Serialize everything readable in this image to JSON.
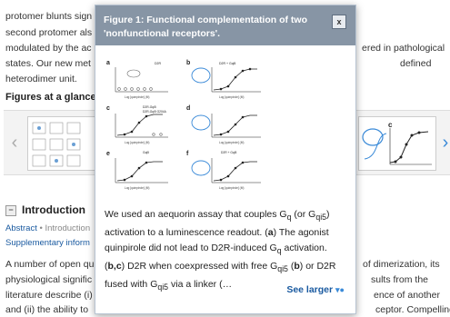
{
  "article": {
    "lines_left": [
      "protomer blunts sign",
      "second protomer als",
      "modulated by the ac",
      "states. Our new met",
      "heterodimer unit."
    ],
    "lines_right": [
      "ered in pathological",
      "defined"
    ],
    "figures_heading": "Figures at a glance",
    "intro_heading": "Introduction",
    "toggle_symbol": "−",
    "abstract_label": "Abstract",
    "breadcrumb_sep": " • Introduction",
    "supp_label": "Supplementary inform",
    "bottom_left": [
      "A number of open qu",
      "physiological signific",
      "literature describe (i)",
      "and (ii) the ability to"
    ],
    "bottom_right": [
      "of dimerization, its",
      "sults from the",
      "ence of another",
      "ceptor. Compelling"
    ],
    "carousel_prev": "‹",
    "carousel_next": "›"
  },
  "popup": {
    "title": "Figure 1: Functional complementation of two 'nonfunctional receptors'.",
    "close_label": "x",
    "caption_parts": {
      "p1": "We used an aequorin assay that couples G",
      "q1": "q",
      "p2": " (or G",
      "qi5_1": "qi5",
      "p3": ") activation to a luminescence readout. (",
      "a": "a",
      "p4": ") The agonist quinpirole did not lead to D2R-induced G",
      "q2": "q",
      "p5": " activation. (",
      "bc": "b,c",
      "p6": ") D2R when coexpressed with free G",
      "qi5_2": "qi5",
      "p7": " (",
      "b": "b",
      "p8": ") or D2R fused with G",
      "qi5_3": "qi5",
      "p9": " via a linker (…"
    },
    "see_larger": "See larger",
    "see_larger_icon": "▾●",
    "panel_labels": [
      "a",
      "b",
      "c",
      "d",
      "e",
      "f"
    ],
    "axis_label": "Log [quinpirole] (M)",
    "y_label": "Activation",
    "legend_a": "D2R",
    "legend_b": "D2R + Gqi5",
    "legend_c1": "D2R-Gqi5",
    "legend_c2": "D2R-Gqi5 G204A",
    "legend_e1": "Gqi5",
    "legend_f": "D2R + Gqi5"
  },
  "colors": {
    "header_bg": "#8795a5",
    "link": "#1a5aa0",
    "accent_blue": "#3a8ad8"
  }
}
